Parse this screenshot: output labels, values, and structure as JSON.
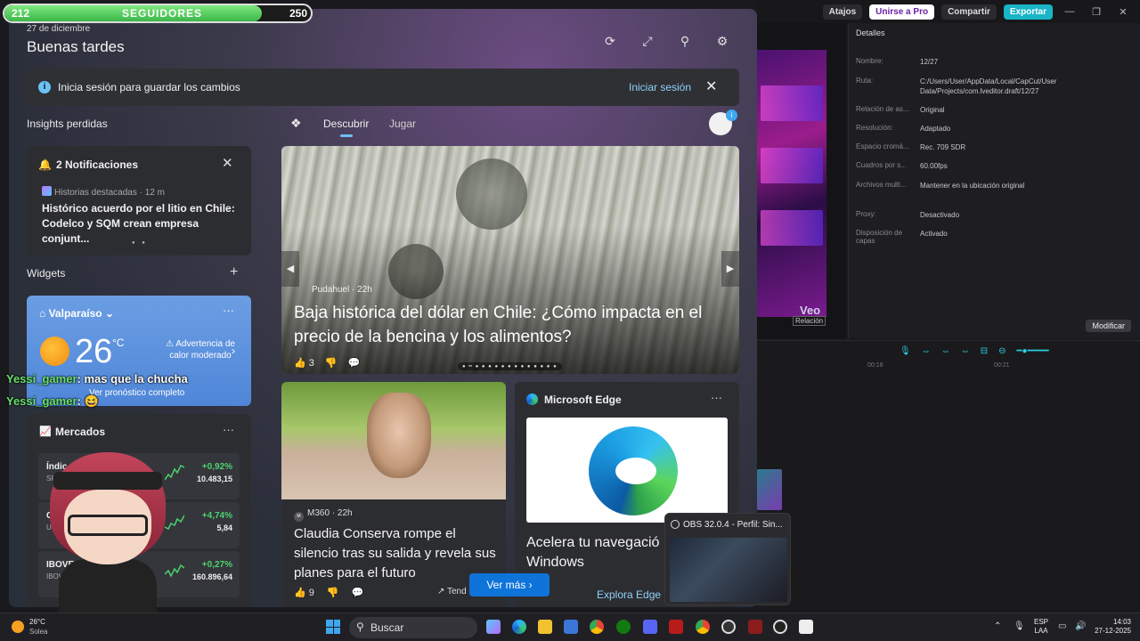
{
  "editor": {
    "top_buttons": [
      "Atajos",
      "Unirse a Pro",
      "Compartir",
      "Exportar"
    ],
    "window_controls": [
      "—",
      "❐",
      "✕"
    ],
    "details_title": "Detalles",
    "details": [
      {
        "key": "Nombre:",
        "value": "12/27"
      },
      {
        "key": "Ruta:",
        "value": "C:/Users/User/AppData/Local/CapCut/User Data/Projects/com.lveditor.draft/12/27"
      },
      {
        "key": "Relación de as...",
        "value": "Original"
      },
      {
        "key": "Resolución:",
        "value": "Adaptado"
      },
      {
        "key": "Espacio cromá...",
        "value": "Rec. 709 SDR"
      },
      {
        "key": "Cuadros por s...",
        "value": "60.00fps"
      },
      {
        "key": "Archivos multi...",
        "value": "Mantener en la ubicación original"
      },
      {
        "key": "Proxy:",
        "value": "Desactivado"
      },
      {
        "key": "Disposición de capas",
        "value": "Activado"
      }
    ],
    "modify_label": "Modificar",
    "preview_watermark": "Veo",
    "ratio_label": "Relación",
    "ruler": [
      "00:18",
      "00:21"
    ]
  },
  "widgets": {
    "date": "27 de diciembre",
    "greeting": "Buenas tardes",
    "signin_banner": {
      "text": "Inicia sesión para guardar los cambios",
      "link": "Iniciar sesión"
    },
    "insights_title": "Insights perdidas",
    "notifications": {
      "title": "2 Notificaciones",
      "source": "Historias destacadas · 12 m",
      "headline": "Histórico acuerdo por el litio en Chile: Codelco y SQM crean empresa conjunt..."
    },
    "widgets_title": "Widgets",
    "weather": {
      "location": "Valparaíso",
      "temperature": "26",
      "unit": "°C",
      "warning": "Advertencia de calor moderado",
      "forecast_link": "Ver pronóstico completo"
    },
    "markets": {
      "title": "Mercados",
      "rows": [
        {
          "name": "Índic",
          "sub": "SPI",
          "change": "+0,92%",
          "value": "10.483,15"
        },
        {
          "name": "C",
          "sub": "U",
          "change": "+4,74%",
          "value": "5,84"
        },
        {
          "name": "IBOVESP",
          "sub": "IBOV",
          "change": "+0,27%",
          "value": "160.896,64"
        }
      ]
    },
    "feed": {
      "tabs": [
        "Descubrir",
        "Jugar"
      ],
      "hero": {
        "source": "Pudahuel · 22h",
        "title": "Baja histórica del dólar en Chile: ¿Cómo impacta en el precio de la bencina y los alimentos?",
        "likes": "3"
      },
      "card2": {
        "source": "M360 · 22h",
        "title": "Claudia Conserva rompe el silencio tras su salida y revela sus planes para el futuro",
        "likes": "9",
        "trend": "Tend"
      },
      "card3": {
        "title": "Microsoft Edge",
        "headline": "Acelera tu navegació Edge en Windows",
        "link": "Explora Edge"
      },
      "see_more": "Ver más"
    }
  },
  "stream_overlay": {
    "followers": {
      "min": "212",
      "label": "SEGUIDORES",
      "max": "250",
      "progress": 0.84
    },
    "chat": [
      {
        "user": "Yessi_gamer",
        "message": ": mas que la chucha"
      },
      {
        "user": "Yessi_gamer",
        "message": ": 😆"
      }
    ]
  },
  "obs_thumbnail": {
    "title": "OBS 32.0.4 - Perfil: Sin..."
  },
  "taskbar": {
    "weather_temp": "26°C",
    "weather_desc": "Solea",
    "search_label": "Buscar",
    "lang_1": "ESP",
    "lang_2": "LAA",
    "time": "14:03",
    "date": "27-12-2025"
  },
  "colors": {
    "accent": "#0e74d9",
    "link": "#8fd0f8",
    "positive": "#4bd36e",
    "weather_bg": "#5a8fdc"
  }
}
